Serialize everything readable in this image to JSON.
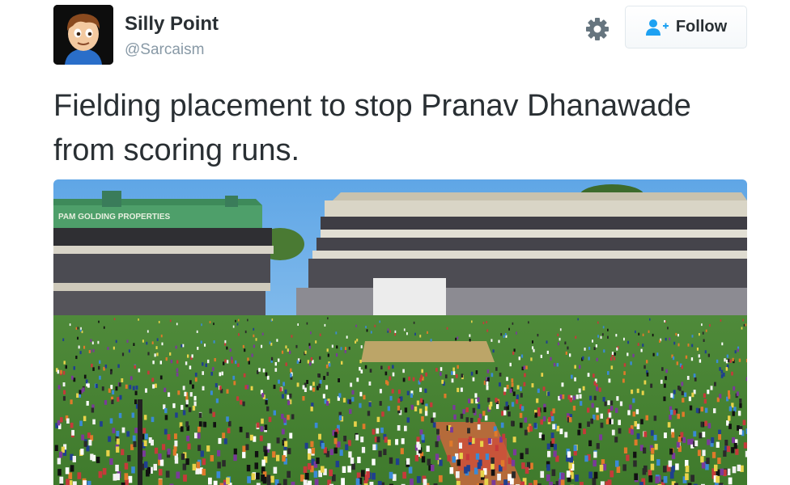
{
  "tweet": {
    "author_name": "Silly Point",
    "author_handle": "@Sarcaism",
    "text": "Fielding placement to stop Pranav Dhanawade from scoring runs.",
    "follow_label": "Follow"
  },
  "photo": {
    "stand_signage": "PAM GOLDING PROPERTIES",
    "description_icon": "stadium-crowd-photo"
  },
  "icons": {
    "settings": "gear-icon",
    "follow": "add-user-icon"
  },
  "colors": {
    "text_primary": "#292f33",
    "text_secondary": "#8899a6",
    "follow_icon": "#1da1f2",
    "gear": "#66757f"
  }
}
